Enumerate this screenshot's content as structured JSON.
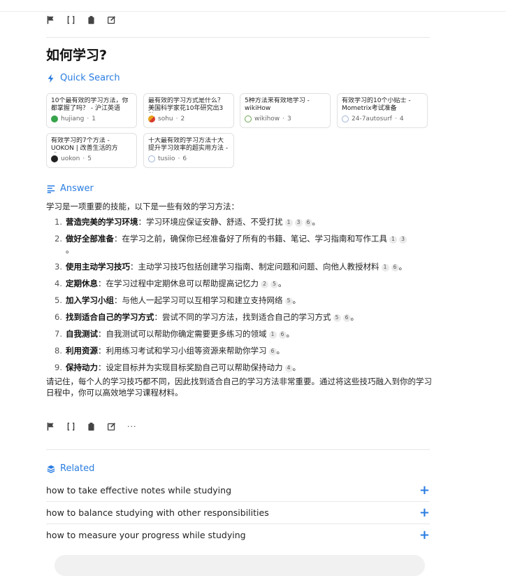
{
  "question": "如何学习?",
  "quick_search": {
    "heading": "Quick Search",
    "cards": [
      {
        "title": "10个最有效的学习方法，你都掌握了吗？ - 沪江英语",
        "source": "hujiang",
        "index": "1",
        "fav_color": "#37a34a"
      },
      {
        "title": "最有效的学习方式是什么？美国科学家花10年研究出3种…",
        "source": "sohu",
        "index": "2",
        "fav_color": "#e8a21c"
      },
      {
        "title": "5种方法来有效地学习 - wikiHow",
        "source": "wikihow",
        "index": "3",
        "fav_color": "#6aa84f"
      },
      {
        "title": "有效学习的10个小贴士 - Mometrix考试准备",
        "source": "24-7autosurf",
        "index": "4",
        "fav_color": "#9fb4d8"
      },
      {
        "title": "有效学习的7个方法 - UOKON | 改善生活的方式-…",
        "source": "uokon",
        "index": "5",
        "fav_color": "#222222"
      },
      {
        "title": "十大最有效的学习方法十大提升学习效率的超实用方法 - …",
        "source": "tusiio",
        "index": "6",
        "fav_color": "#9fb4d8"
      }
    ]
  },
  "answer": {
    "heading": "Answer",
    "intro": "学习是一项重要的技能，以下是一些有效的学习方法：",
    "items": [
      {
        "num": "1.",
        "bold": "营造完美的学习环境",
        "text": "：学习环境应保证安静、舒适、不受打扰",
        "cites": [
          "1",
          "3",
          "6"
        ],
        "end": "。"
      },
      {
        "num": "2.",
        "bold": "做好全部准备",
        "text": "：在学习之前，确保你已经准备好了所有的书籍、笔记、学习指南和写作工具",
        "cites": [
          "1",
          "3"
        ],
        "end": "。"
      },
      {
        "num": "3.",
        "bold": "使用主动学习技巧",
        "text": "：主动学习技巧包括创建学习指南、制定问题和问题、向他人教授材料",
        "cites": [
          "1",
          "6"
        ],
        "end": "。"
      },
      {
        "num": "4.",
        "bold": "定期休息",
        "text": "：在学习过程中定期休息可以帮助提高记忆力",
        "cites": [
          "2",
          "5"
        ],
        "end": "。"
      },
      {
        "num": "5.",
        "bold": "加入学习小组",
        "text": "：与他人一起学习可以互相学习和建立支持网络",
        "cites": [
          "5"
        ],
        "end": "。"
      },
      {
        "num": "6.",
        "bold": "找到适合自己的学习方式",
        "text": "：尝试不同的学习方法，找到适合自己的学习方式",
        "cites": [
          "5",
          "6"
        ],
        "end": "。"
      },
      {
        "num": "7.",
        "bold": "自我测试",
        "text": "：自我测试可以帮助你确定需要更多练习的领域",
        "cites": [
          "1",
          "6"
        ],
        "end": "。"
      },
      {
        "num": "8.",
        "bold": "利用资源",
        "text": "：利用练习考试和学习小组等资源来帮助你学习",
        "cites": [
          "6"
        ],
        "end": "。"
      },
      {
        "num": "9.",
        "bold": "保持动力",
        "text": "：设定目标并为实现目标奖励自己可以帮助保持动力",
        "cites": [
          "4"
        ],
        "end": "。"
      }
    ],
    "outro": "请记住，每个人的学习技巧都不同，因此找到适合自己的学习方法非常重要。通过将这些技巧融入到你的学习日程中，你可以高效地学习课程材料。"
  },
  "related": {
    "heading": "Related",
    "items": [
      "how to take effective notes while studying",
      "how to balance studying with other responsibilities",
      "how to measure your progress while studying"
    ],
    "plus": "+"
  },
  "toolbar": {
    "more": "···"
  },
  "colors": {
    "accent": "#2a7de1"
  }
}
